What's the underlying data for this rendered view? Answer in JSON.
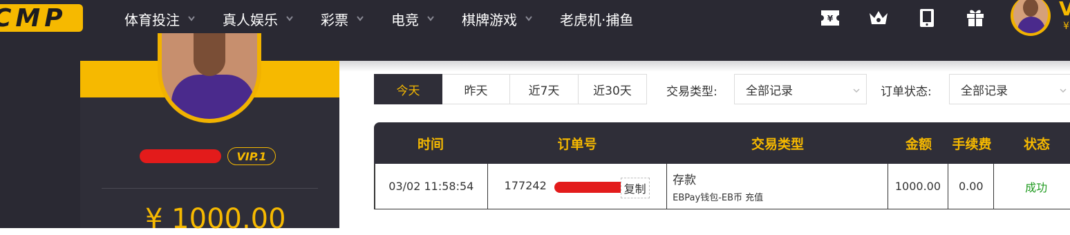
{
  "logo": {
    "text": "CMP"
  },
  "nav": {
    "items": [
      {
        "label": "体育投注",
        "has_dropdown": true
      },
      {
        "label": "真人娱乐",
        "has_dropdown": true
      },
      {
        "label": "彩票",
        "has_dropdown": true
      },
      {
        "label": "电竞",
        "has_dropdown": true
      },
      {
        "label": "棋牌游戏",
        "has_dropdown": true
      },
      {
        "label": "老虎机·捕鱼",
        "has_dropdown": false
      }
    ]
  },
  "top_icons": [
    "ticket-icon",
    "crown-icon",
    "tablet-icon",
    "gift-icon"
  ],
  "profile": {
    "vip": "VIP.1",
    "balance": "¥ 1000.00"
  },
  "filters": {
    "range_tabs": [
      "今天",
      "昨天",
      "近7天",
      "近30天"
    ],
    "active_tab": "今天",
    "type_label": "交易类型:",
    "type_value": "全部记录",
    "status_label": "订单状态:",
    "status_value": "全部记录"
  },
  "table": {
    "headers": [
      "时间",
      "订单号",
      "交易类型",
      "金额",
      "手续费",
      "状态"
    ],
    "rows": [
      {
        "time": "03/02 11:58:54",
        "order_visible": "177242",
        "copy_label": "复制",
        "type_main": "存款",
        "type_sub": "EBPay钱包-EB币 充值",
        "amount": "1000.00",
        "fee": "0.00",
        "status": "成功"
      }
    ]
  },
  "colors": {
    "dark": "#2a2933",
    "accent": "#f6b900",
    "success": "#1e9a1e",
    "redaction": "#e31b1b"
  }
}
